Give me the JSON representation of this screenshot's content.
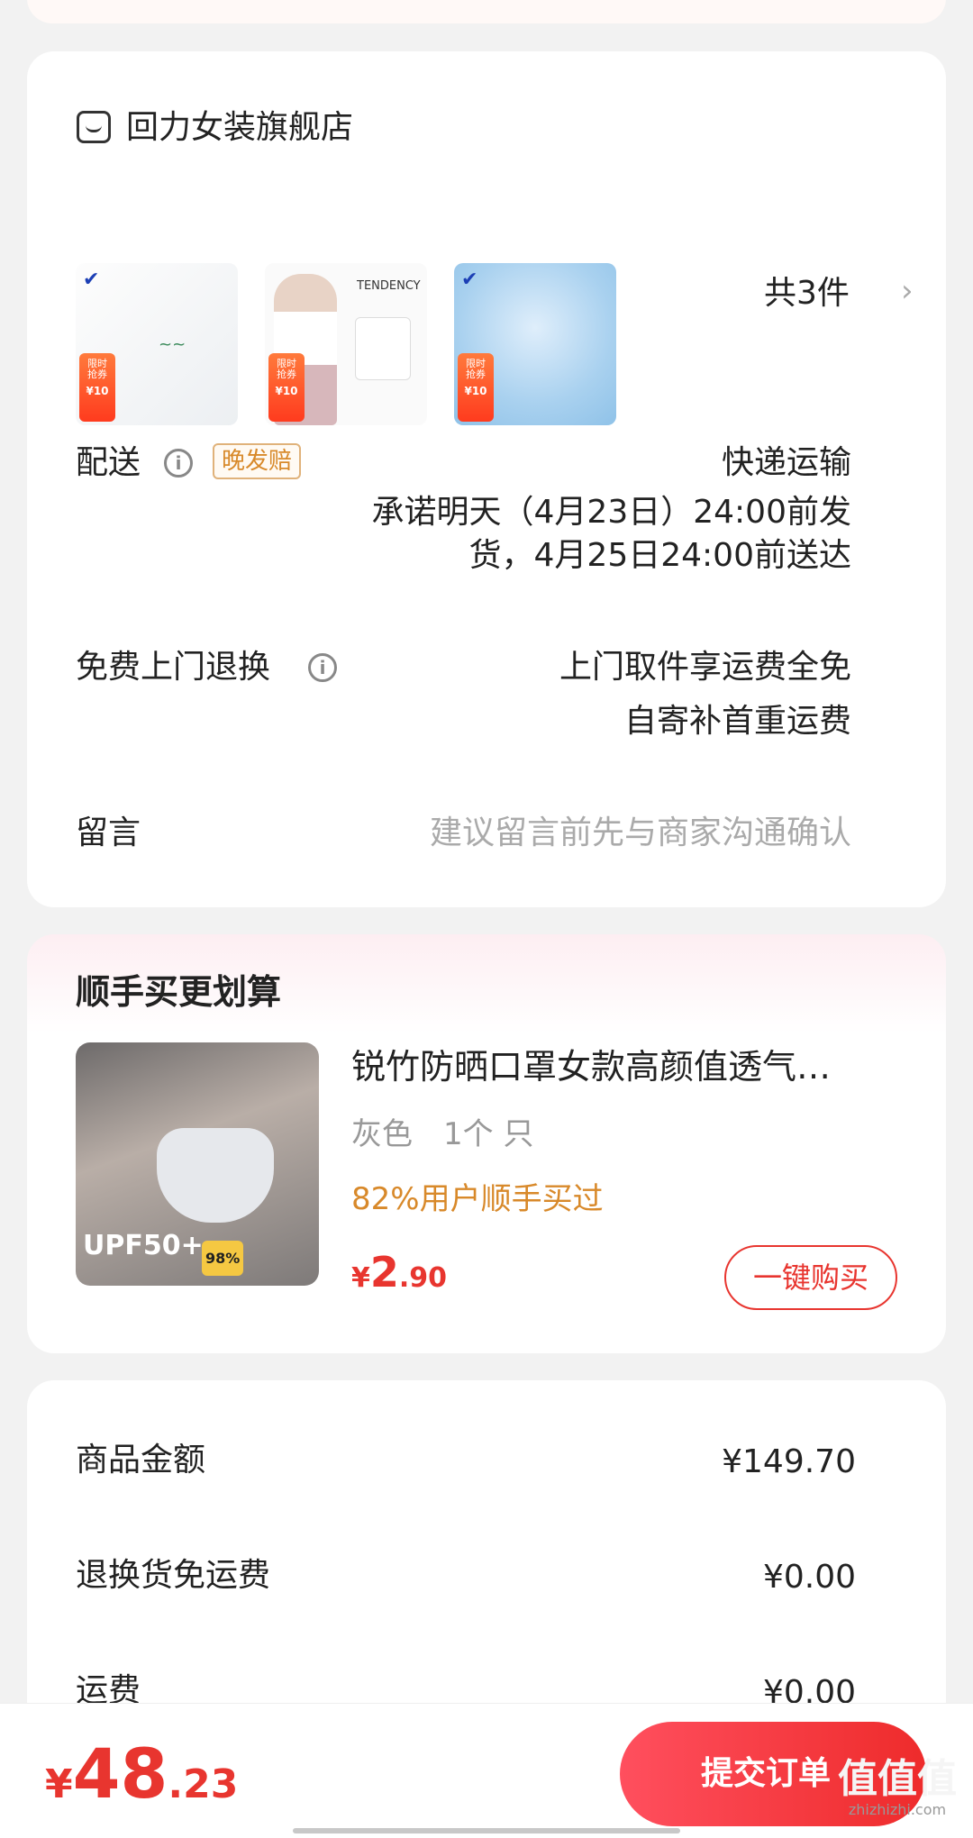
{
  "store": {
    "name": "回力女装旗舰店",
    "thumbs": [
      {
        "tag_line1": "限时",
        "tag_line2": "抢券",
        "tag_price": "¥10"
      },
      {
        "tag_line1": "限时",
        "tag_line2": "抢券",
        "tag_price": "¥10",
        "text": "TENDENCY"
      },
      {
        "tag_line1": "限时",
        "tag_line2": "抢券",
        "tag_price": "¥10"
      }
    ],
    "count_label": "共3件"
  },
  "delivery": {
    "label": "配送",
    "badge": "晚发赔",
    "method": "快递运输",
    "promise_line1": "承诺明天（4月23日）24:00前发",
    "promise_line2": "货，4月25日24:00前送达"
  },
  "returns": {
    "label": "免费上门退换",
    "line1": "上门取件享运费全免",
    "line2": "自寄补首重运费"
  },
  "message": {
    "label": "留言",
    "placeholder": "建议留言前先与商家沟通确认"
  },
  "addon": {
    "section_title": "顺手买更划算",
    "product_title": "锐竹防晒口罩女款高颜值透气…",
    "spec": "灰色　1个 只",
    "social_proof": "82%用户顺手买过",
    "price_symbol": "¥",
    "price_int": "2",
    "price_dec": ".90",
    "buy_button": "一键购买",
    "image_text": "UPF50+",
    "image_badge": "98%"
  },
  "summary": {
    "rows": [
      {
        "label": "商品金额",
        "value": "¥149.70"
      },
      {
        "label": "退换货免运费",
        "value": "¥0.00"
      },
      {
        "label": "运费",
        "value": "¥0.00"
      }
    ]
  },
  "footer": {
    "price_symbol": "¥",
    "price_int": "48",
    "price_dec": ".23",
    "submit_label": "提交订单"
  },
  "watermark": {
    "text": "值值值",
    "sub": "zhizhizhi.com"
  },
  "colors": {
    "accent": "#e8352f",
    "orange": "#d8892a"
  }
}
